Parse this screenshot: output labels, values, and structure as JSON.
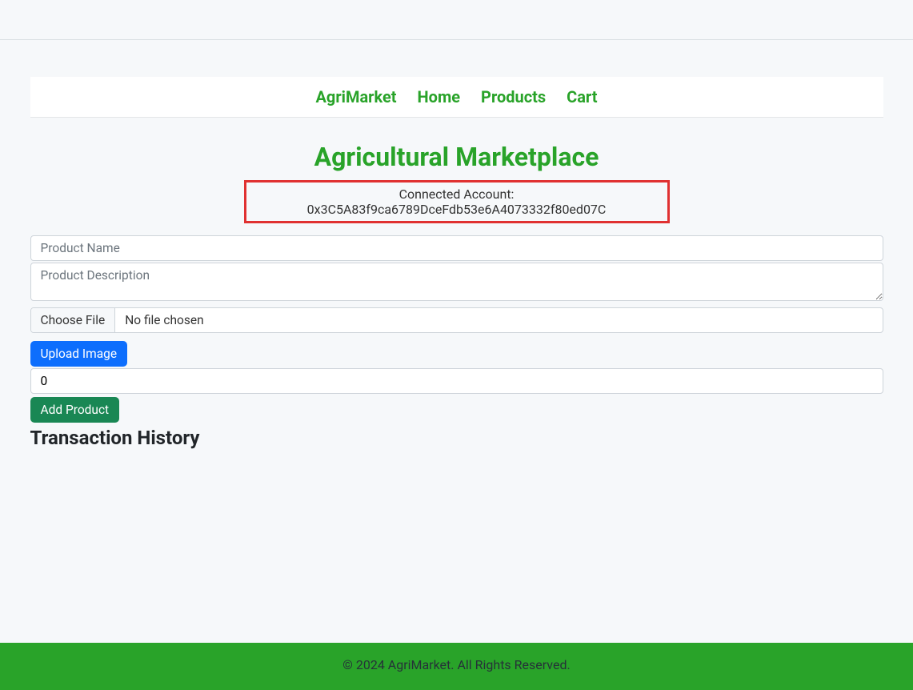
{
  "nav": {
    "brand": "AgriMarket",
    "links": [
      "Home",
      "Products",
      "Cart"
    ]
  },
  "page_title": "Agricultural Marketplace",
  "account": {
    "label": "Connected Account: ",
    "address": "0x3C5A83f9ca6789DceFdb53e6A4073332f80ed07C"
  },
  "form": {
    "product_name_placeholder": "Product Name",
    "product_name_value": "",
    "product_desc_placeholder": "Product Description",
    "product_desc_value": "",
    "file_button_label": "Choose File",
    "file_status": "No file chosen",
    "upload_button_label": "Upload Image",
    "price_value": "0",
    "add_button_label": "Add Product"
  },
  "history_heading": "Transaction History",
  "footer_text": "© 2024 AgriMarket. All Rights Reserved."
}
